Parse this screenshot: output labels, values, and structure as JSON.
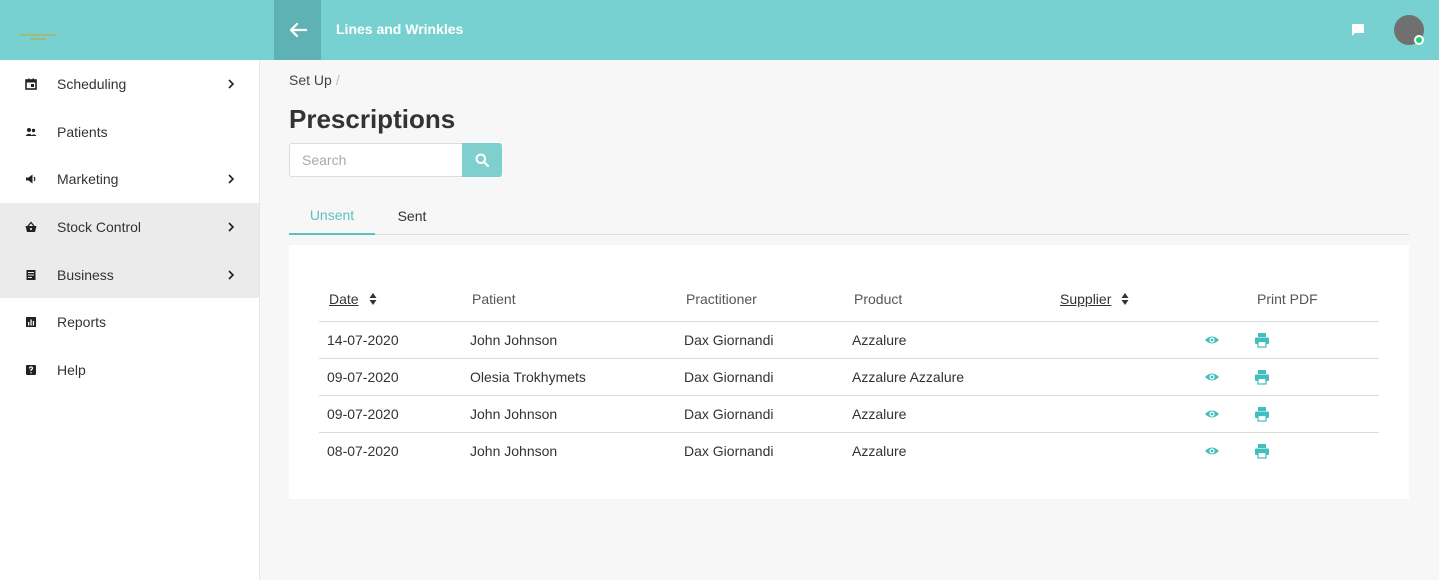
{
  "header": {
    "title": "Lines and Wrinkles",
    "back_icon": "arrow-left-icon",
    "chat_icon": "chat-icon",
    "accent_color": "#78d1d1",
    "status_color": "#2ecc71"
  },
  "sidebar": {
    "items": [
      {
        "label": "Scheduling",
        "icon": "calendar-icon",
        "has_submenu": true
      },
      {
        "label": "Patients",
        "icon": "people-icon",
        "has_submenu": false
      },
      {
        "label": "Marketing",
        "icon": "megaphone-icon",
        "has_submenu": true
      },
      {
        "label": "Stock Control",
        "icon": "basket-icon",
        "has_submenu": true
      },
      {
        "label": "Business",
        "icon": "document-icon",
        "has_submenu": true
      },
      {
        "label": "Reports",
        "icon": "chart-icon",
        "has_submenu": false
      },
      {
        "label": "Help",
        "icon": "help-icon",
        "has_submenu": false
      }
    ]
  },
  "breadcrumb": {
    "item": "Set Up",
    "separator": "/"
  },
  "page": {
    "title": "Prescriptions"
  },
  "search": {
    "placeholder": "Search",
    "icon": "search-icon"
  },
  "tabs": [
    {
      "label": "Unsent",
      "active": true
    },
    {
      "label": "Sent",
      "active": false
    }
  ],
  "table": {
    "columns": [
      "Date",
      "Patient",
      "Practitioner",
      "Product",
      "Supplier",
      "Print PDF"
    ],
    "rows": [
      {
        "date": "14-07-2020",
        "patient": "John Johnson",
        "practitioner": "Dax Giornandi",
        "product": "Azzalure",
        "supplier": ""
      },
      {
        "date": "09-07-2020",
        "patient": "Olesia Trokhymets",
        "practitioner": "Dax Giornandi",
        "product": "Azzalure Azzalure",
        "supplier": ""
      },
      {
        "date": "09-07-2020",
        "patient": "John Johnson",
        "practitioner": "Dax Giornandi",
        "product": "Azzalure",
        "supplier": ""
      },
      {
        "date": "08-07-2020",
        "patient": "John Johnson",
        "practitioner": "Dax Giornandi",
        "product": "Azzalure",
        "supplier": ""
      }
    ],
    "row_actions": [
      "eye-icon",
      "printer-icon"
    ]
  }
}
